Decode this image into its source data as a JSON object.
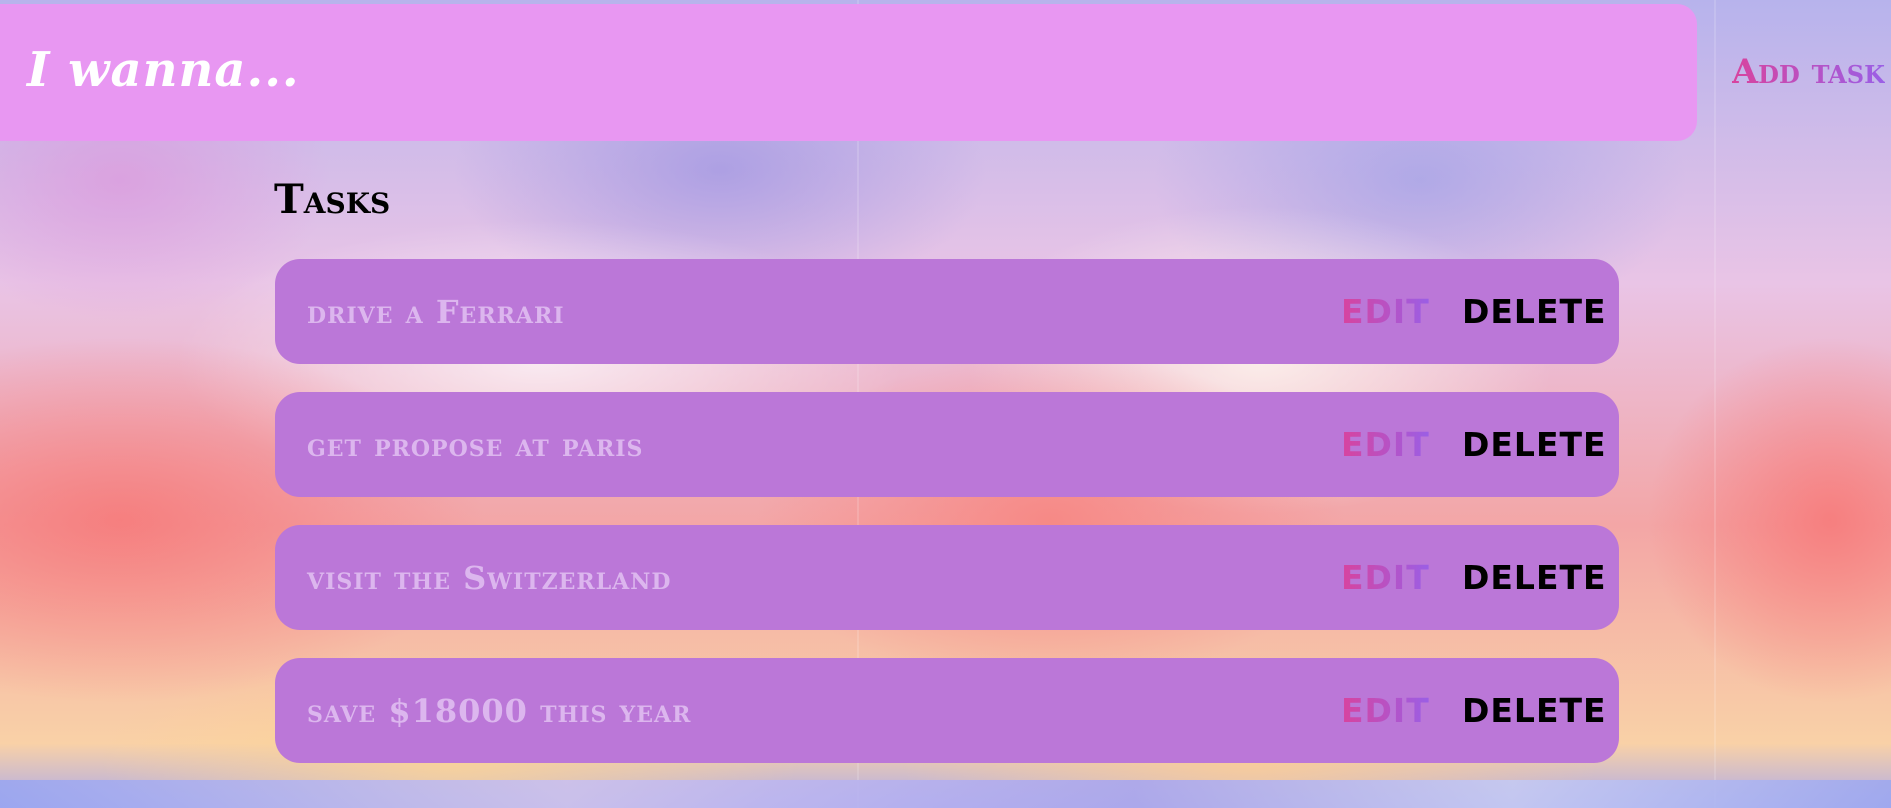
{
  "header": {
    "title": "I wanna...",
    "add_task_label": "Add task"
  },
  "tasks_section": {
    "heading": "Tasks",
    "items": [
      {
        "text": "drive a Ferrari",
        "edit_label": "EDIT",
        "delete_label": "DELETE"
      },
      {
        "text": "get propose at paris",
        "edit_label": "EDIT",
        "delete_label": "DELETE"
      },
      {
        "text": "visit the Switzerland",
        "edit_label": "EDIT",
        "delete_label": "DELETE"
      },
      {
        "text": "save $18000 this year",
        "edit_label": "EDIT",
        "delete_label": "DELETE"
      }
    ]
  },
  "colors": {
    "header_bg": "#e897f2",
    "task_bg": "#bb77d8",
    "task_text": "#dcb6ee",
    "accent_pink": "#d8439e",
    "accent_purple": "#9a5fe6"
  }
}
